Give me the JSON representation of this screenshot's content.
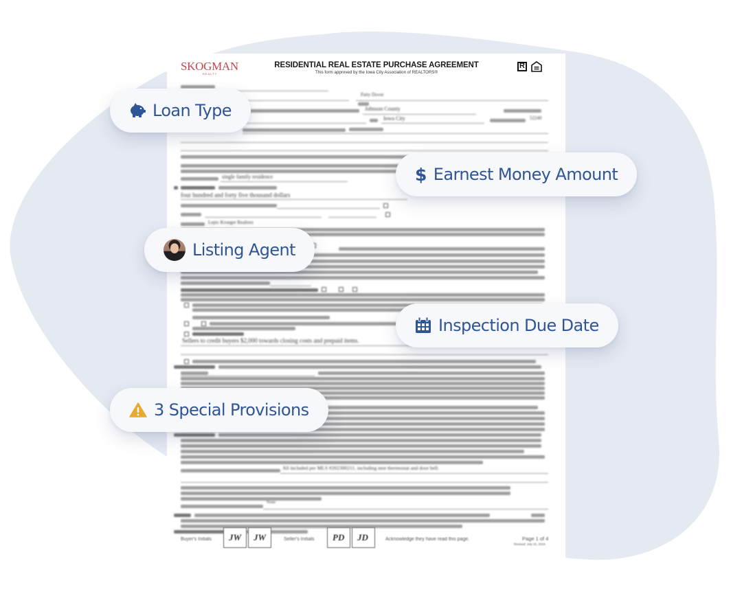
{
  "colors": {
    "accent_text": "#2f5596",
    "pill_bg": "#f7f8fb",
    "blob_bg": "#e5e9f2",
    "warning": "#e6ab2e",
    "logo": "#c0484e"
  },
  "document": {
    "logo": {
      "name": "SKOGMAN",
      "subtitle": "REALTY"
    },
    "title": "RESIDENTIAL REAL ESTATE PURCHASE AGREEMENT",
    "subtitle": "This form approved by the Iowa City Association of REALTORS®",
    "visible_fields": {
      "seller_name": "Patty Dover",
      "county": "Johnson County",
      "city": "Iowa City",
      "zip": "52240",
      "use": "single family residence",
      "purchase_price_words": "four hundred and forty five thousand dollars",
      "escrow_holder": "Lepic Kroeger Realtors",
      "other_financing_terms": "Sellers to credit buyers $2,000 towards closing costs and prepaid items.",
      "included_items": "All included per MLS #202300211, including nest thermostat and door bell.",
      "excluded_items": "None"
    },
    "initials": {
      "buyer_label": "Buyer's Initials",
      "seller_label": "Seller's Initials",
      "buyer_marks": [
        "JW",
        "JW"
      ],
      "seller_marks": [
        "PD",
        "JD"
      ],
      "acknowledge_text": "Acknowledge they have read this page."
    },
    "footer": {
      "page": "Page 1 of 4",
      "revision": "Revised: July 15, 2019"
    }
  },
  "highlights": [
    {
      "label": "Loan Type",
      "icon": "piggy-bank-icon"
    },
    {
      "label": "Earnest Money Amount",
      "icon": "dollar-icon",
      "icon_glyph": "$"
    },
    {
      "label": "Listing Agent",
      "icon": "agent-avatar"
    },
    {
      "label": "Inspection Due Date",
      "icon": "calendar-icon"
    },
    {
      "label": "3 Special Provisions",
      "icon": "warning-icon"
    }
  ]
}
